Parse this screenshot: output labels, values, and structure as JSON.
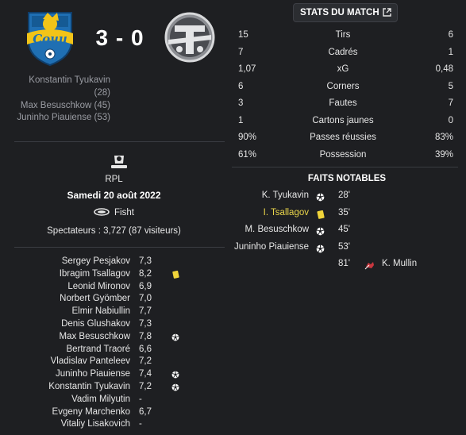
{
  "match": {
    "home_goals": "3",
    "dash": "-",
    "away_goals": "0",
    "scorers": [
      "Konstantin Tyukavin",
      "(28)",
      "Max Besuschkow (45)",
      "Juninho Piauiense (53)"
    ],
    "competition": "RPL",
    "date": "Samedi 20 août 2022",
    "stadium": "Fisht",
    "attendance": "Spectateurs : 3,727 (87 visiteurs)"
  },
  "ratings": [
    {
      "name": "Sergey Pesjakov",
      "rating": "7,3",
      "icon": ""
    },
    {
      "name": "Ibragim Tsallagov",
      "rating": "8,2",
      "icon": "yellow-card-icon"
    },
    {
      "name": "Leonid Mironov",
      "rating": "6,9",
      "icon": ""
    },
    {
      "name": "Norbert Gyömber",
      "rating": "7,0",
      "icon": ""
    },
    {
      "name": "Elmir Nabiullin",
      "rating": "7,7",
      "icon": ""
    },
    {
      "name": "Denis Glushakov",
      "rating": "7,3",
      "icon": ""
    },
    {
      "name": "Max Besuschkow",
      "rating": "7,8",
      "icon": "goal-ball-icon"
    },
    {
      "name": "Bertrand Traoré",
      "rating": "6,6",
      "icon": ""
    },
    {
      "name": "Vladislav Panteleev",
      "rating": "7,2",
      "icon": ""
    },
    {
      "name": "Juninho Piauiense",
      "rating": "7,4",
      "icon": "goal-ball-icon"
    },
    {
      "name": "Konstantin Tyukavin",
      "rating": "7,2",
      "icon": "goal-ball-icon"
    },
    {
      "name": "Vadim Milyutin",
      "rating": "-",
      "icon": ""
    },
    {
      "name": "Evgeny Marchenko",
      "rating": "6,7",
      "icon": ""
    },
    {
      "name": "Vitaliy Lisakovich",
      "rating": "-",
      "icon": ""
    }
  ],
  "stats": {
    "header_label": "STATS DU MATCH",
    "rows": [
      {
        "home": "15",
        "label": "Tirs",
        "away": "6"
      },
      {
        "home": "7",
        "label": "Cadrés",
        "away": "1"
      },
      {
        "home": "1,07",
        "label": "xG",
        "away": "0,48"
      },
      {
        "home": "6",
        "label": "Corners",
        "away": "5"
      },
      {
        "home": "3",
        "label": "Fautes",
        "away": "7"
      },
      {
        "home": "1",
        "label": "Cartons jaunes",
        "away": "0"
      },
      {
        "home": "90%",
        "label": "Passes réussies",
        "away": "83%"
      },
      {
        "home": "61%",
        "label": "Possession",
        "away": "39%"
      }
    ]
  },
  "events": {
    "title": "FAITS NOTABLES",
    "rows": [
      {
        "home_name": "K. Tyukavin",
        "home_icon": "goal-ball-icon",
        "minute": "28'",
        "away_icon": "",
        "away_name": "",
        "highlight": false
      },
      {
        "home_name": "I. Tsallagov",
        "home_icon": "yellow-card-icon",
        "minute": "35'",
        "away_icon": "",
        "away_name": "",
        "highlight": true
      },
      {
        "home_name": "M. Besuschkow",
        "home_icon": "goal-ball-icon",
        "minute": "45'",
        "away_icon": "",
        "away_name": "",
        "highlight": false
      },
      {
        "home_name": "Juninho Piauiense",
        "home_icon": "goal-ball-icon",
        "minute": "53'",
        "away_icon": "",
        "away_name": "",
        "highlight": false
      },
      {
        "home_name": "",
        "home_icon": "",
        "minute": "81'",
        "away_icon": "injury-icon",
        "away_name": "K. Mullin",
        "highlight": false
      }
    ]
  },
  "colors": {
    "background": "#1e1f22",
    "yellow_card": "#f0d43a",
    "injury": "#c9373f",
    "home_crest_blue": "#1f6fb3",
    "home_crest_yellow": "#f2c418"
  }
}
